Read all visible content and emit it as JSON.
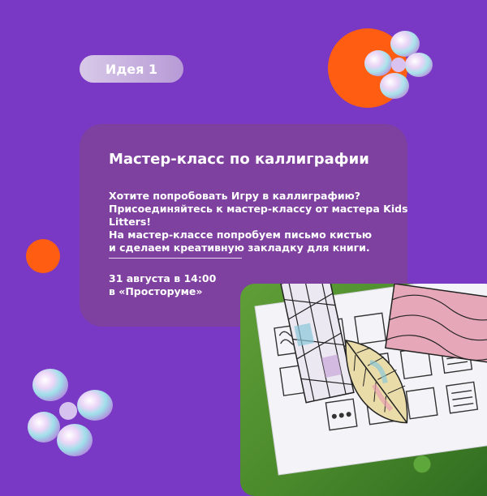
{
  "badge": {
    "label": "Идея 1"
  },
  "card": {
    "title": "Мастер-класс по каллиграфии",
    "description_lines": [
      "Хотите попробовать Игру в каллиграфию?",
      "Присоединяйтесь к мастер-классу от мастера Kids",
      "Litters!",
      "На мастер-классе попробуем письмо кистью",
      "и сделаем креативную закладку для книги."
    ],
    "event_lines": [
      "31 августа в 14:00",
      "в «Простоpуме»"
    ]
  },
  "colors": {
    "background": "#7a39c4",
    "card": "#7e419f",
    "accent_orange": "#ff5d12"
  },
  "photo": {
    "subject": "calligraphy practice sheet and patterned paper feather on grass"
  }
}
